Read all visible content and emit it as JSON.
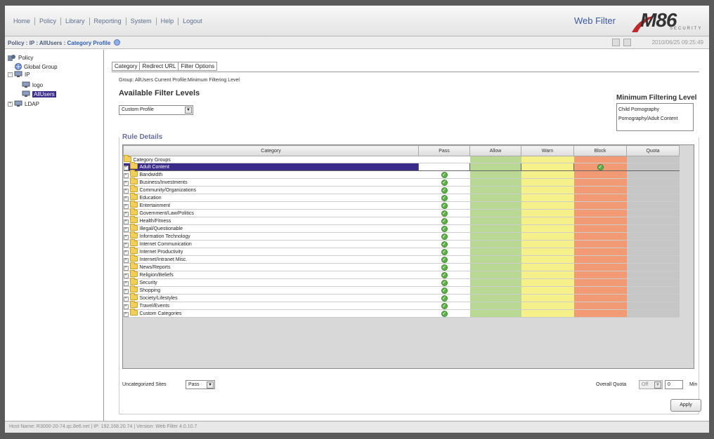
{
  "nav": [
    "Home",
    "Policy",
    "Library",
    "Reporting",
    "System",
    "Help",
    "Logout"
  ],
  "app_title": "Web Filter",
  "logo": {
    "text": "M86",
    "sub": "SECURITY"
  },
  "breadcrumb": {
    "path": "Policy : IP : AllUsers : ",
    "current": "Category Profile"
  },
  "timestamp": "2010/06/25 09:25:49",
  "tree": {
    "root": "Policy",
    "global_group": "Global Group",
    "ip": "IP",
    "logo": "logo",
    "allusers": "AllUsers",
    "ldap": "LDAP"
  },
  "tabs": [
    "Category",
    "Redirect URL",
    "Filter Options"
  ],
  "group_info": "Group: AllUsers   Current Profile:Minimum Filtering Level",
  "available_filter_levels": "Available Filter Levels",
  "profile_select": "Custom Profile",
  "min_filtering": {
    "title": "Minimum Filtering Level",
    "items": [
      "Child Pornography",
      "Pornography/Adult Content"
    ]
  },
  "rule_details": "Rule Details",
  "columns": [
    "Category",
    "Pass",
    "Allow",
    "Warn",
    "Block",
    "Quota"
  ],
  "category_groups_label": "Category Groups",
  "rows": [
    {
      "name": "Adult Content",
      "state": "block",
      "selected": true
    },
    {
      "name": "Bandwidth",
      "state": "pass"
    },
    {
      "name": "Business/Investments",
      "state": "pass"
    },
    {
      "name": "Community/Organizations",
      "state": "pass"
    },
    {
      "name": "Education",
      "state": "pass"
    },
    {
      "name": "Entertainment",
      "state": "pass"
    },
    {
      "name": "Government/Law/Politics",
      "state": "pass"
    },
    {
      "name": "Health/Fitness",
      "state": "pass"
    },
    {
      "name": "Illegal/Questionable",
      "state": "pass"
    },
    {
      "name": "Information Technology",
      "state": "pass"
    },
    {
      "name": "Internet Communication",
      "state": "pass"
    },
    {
      "name": "Internet Productivity",
      "state": "pass"
    },
    {
      "name": "Internet/Intranet Misc.",
      "state": "pass"
    },
    {
      "name": "News/Reports",
      "state": "pass"
    },
    {
      "name": "Religion/Beliefs",
      "state": "pass"
    },
    {
      "name": "Security",
      "state": "pass"
    },
    {
      "name": "Shopping",
      "state": "pass"
    },
    {
      "name": "Society/Lifestyles",
      "state": "pass"
    },
    {
      "name": "Travel/Events",
      "state": "pass"
    },
    {
      "name": "Custom Categories",
      "state": "pass"
    }
  ],
  "uncategorized": {
    "label": "Uncategorized Sites",
    "value": "Pass"
  },
  "overall_quota": {
    "label": "Overall Quota",
    "select": "Off",
    "value": "0",
    "unit": "Min"
  },
  "apply_label": "Apply",
  "status": "Host Name: R3000-20-74.qc.8e6.net  |  IP: 192.168.20.74  |  Version: Web Filter 4.0.10.7",
  "colors": {
    "allow": "#b8d894",
    "warn": "#f6f08a",
    "block": "#f29a74",
    "quota": "#c6c6c6",
    "selection": "#3a2a8a"
  },
  "icons": [
    "policy-icon",
    "globe-icon",
    "network-icon",
    "folder-icon",
    "check-icon",
    "help-icon"
  ]
}
